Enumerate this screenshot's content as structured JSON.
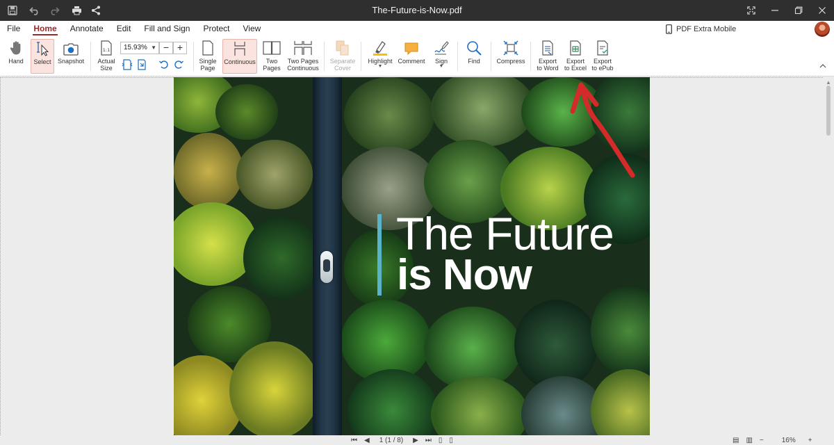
{
  "title_bar": {
    "document_title": "The-Future-is-Now.pdf",
    "left_icons": [
      "save-icon",
      "undo-icon",
      "redo-icon",
      "print-icon",
      "share-icon"
    ],
    "window_controls": [
      "fullscreen-icon",
      "minimize-icon",
      "restore-icon",
      "close-icon"
    ],
    "background_color": "#2f2f2f"
  },
  "menu": {
    "items": [
      {
        "label": "File",
        "active": false
      },
      {
        "label": "Home",
        "active": true
      },
      {
        "label": "Annotate",
        "active": false
      },
      {
        "label": "Edit",
        "active": false
      },
      {
        "label": "Fill and Sign",
        "active": false
      },
      {
        "label": "Protect",
        "active": false
      },
      {
        "label": "View",
        "active": false
      }
    ],
    "mobile_label": "PDF Extra Mobile",
    "accent_color": "#9c2a2a"
  },
  "ribbon": {
    "hand": "Hand",
    "select": "Select",
    "snapshot": "Snapshot",
    "actual_size_line1": "Actual",
    "actual_size_line2": "Size",
    "zoom_value": "15.93%",
    "zoom_minus": "−",
    "zoom_plus": "+",
    "single_page_line1": "Single",
    "single_page_line2": "Page",
    "continuous": "Continuous",
    "two_pages_line1": "Two",
    "two_pages_line2": "Pages",
    "two_pages_cont_line1": "Two Pages",
    "two_pages_cont_line2": "Continuous",
    "separate_cover_line1": "Separate",
    "separate_cover_line2": "Cover",
    "highlight": "Highlight",
    "comment": "Comment",
    "sign": "Sign",
    "find": "Find",
    "compress": "Compress",
    "export_word_line1": "Export",
    "export_word_line2": "to Word",
    "export_excel_line1": "Export",
    "export_excel_line2": "to Excel",
    "export_epub_line1": "Export",
    "export_epub_line2": "to ePub",
    "pressed_color": "#fbe4e0"
  },
  "document": {
    "heading_line1": "The Future",
    "heading_line2": "is Now",
    "accent_bar_color": "#5ab3c9"
  },
  "status_bar": {
    "page_indicator": "1 (1 / 8)",
    "zoom_percent": "16%",
    "zoom_minus": "−",
    "zoom_plus": "+"
  },
  "annotation": {
    "arrow_color": "#d42a2a"
  }
}
